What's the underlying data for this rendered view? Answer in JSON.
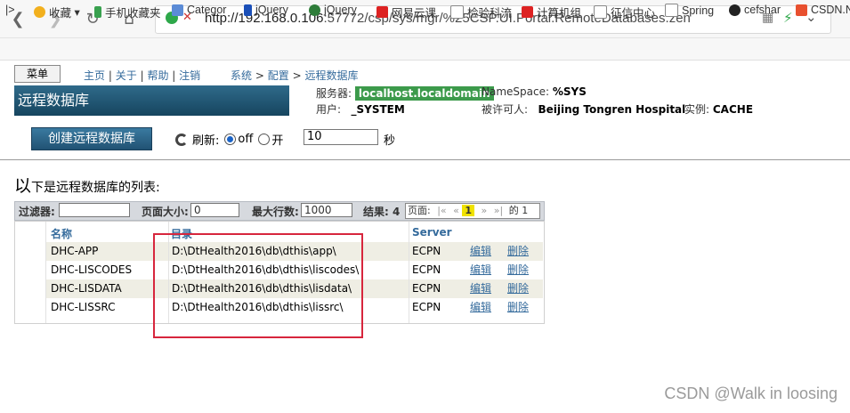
{
  "browser": {
    "url_host": "http://192.168.0.106",
    "url_rest": ":57772/csp/sys/mgr/%25CSP.UI.Portal.RemoteDatabases.zen",
    "bookmarks": [
      "收藏",
      "手机收藏夹",
      "Categor",
      "jQuery",
      "jQuery",
      "网易云课",
      "检验科流",
      "计算机组",
      "征信中心",
      "Spring",
      "cefshar",
      "CSDN.N"
    ]
  },
  "header": {
    "menu_label": "菜单",
    "links": [
      "主页",
      "关于",
      "帮助",
      "注销"
    ],
    "breadcrumb": [
      "系统",
      "配置",
      "远程数据库"
    ],
    "page_title": "远程数据库",
    "server_label": "服务器:",
    "server_value": "localhost.localdomain",
    "namespace_label": "NameSpace:",
    "namespace_value": "%SYS",
    "user_label": "用户:",
    "user_value": "_SYSTEM",
    "licensee_label": "被许可人:",
    "licensee_value": "Beijing Tongren Hospital",
    "instance_label": "实例:",
    "instance_value": "CACHE"
  },
  "actions": {
    "create_label": "创建远程数据库",
    "refresh_label": "刷新:",
    "off_label": "off",
    "on_label": "开",
    "seconds_value": "10",
    "seconds_unit": "秒"
  },
  "list": {
    "title_first": "以",
    "title_rest": "下是远程数据库的列表:",
    "filter_label": "过滤器:",
    "filter_value": "",
    "page_size_label": "页面大小:",
    "page_size_value": "0",
    "max_rows_label": "最大行数:",
    "max_rows_value": "1000",
    "results_label": "结果: 4",
    "page_label": "页面:",
    "page_first": "|«",
    "page_prev": "«",
    "page_current": "1",
    "page_next": "»",
    "page_last": "»|",
    "page_of": "的 1",
    "columns": [
      "名称",
      "目录",
      "Server"
    ],
    "rows": [
      {
        "name": "DHC-APP",
        "dir": "D:\\DtHealth2016\\db\\dthis\\app\\",
        "server": "ECPN",
        "edit": "编辑",
        "delete": "删除"
      },
      {
        "name": "DHC-LISCODES",
        "dir": "D:\\DtHealth2016\\db\\dthis\\liscodes\\",
        "server": "ECPN",
        "edit": "编辑",
        "delete": "删除"
      },
      {
        "name": "DHC-LISDATA",
        "dir": "D:\\DtHealth2016\\db\\dthis\\lisdata\\",
        "server": "ECPN",
        "edit": "编辑",
        "delete": "删除"
      },
      {
        "name": "DHC-LISSRC",
        "dir": "D:\\DtHealth2016\\db\\dthis\\lissrc\\",
        "server": "ECPN",
        "edit": "编辑",
        "delete": "删除"
      }
    ]
  },
  "watermark": "CSDN @Walk in loosing"
}
